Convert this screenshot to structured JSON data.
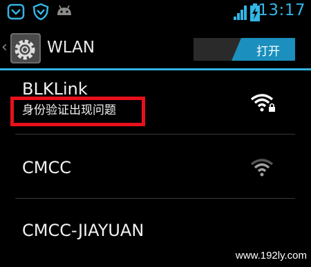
{
  "status_bar": {
    "icons": [
      "notification-icon",
      "shield-icon",
      "android-icon",
      "signal-icon",
      "battery-charging-icon"
    ],
    "time": "13:17"
  },
  "header": {
    "title": "WLAN",
    "toggle_label": "打开",
    "accent_color": "#33b5e5"
  },
  "networks": [
    {
      "name": "BLKLink",
      "status": "身份验证出现问题",
      "secured": true,
      "signal": "full"
    },
    {
      "name": "CMCC",
      "status": "",
      "secured": false,
      "signal": "medium"
    },
    {
      "name": "CMCC-JIAYUAN",
      "status": "",
      "secured": false,
      "signal": "none"
    }
  ],
  "annotation_color": "#e8101c",
  "watermark": "www.192ly.com"
}
